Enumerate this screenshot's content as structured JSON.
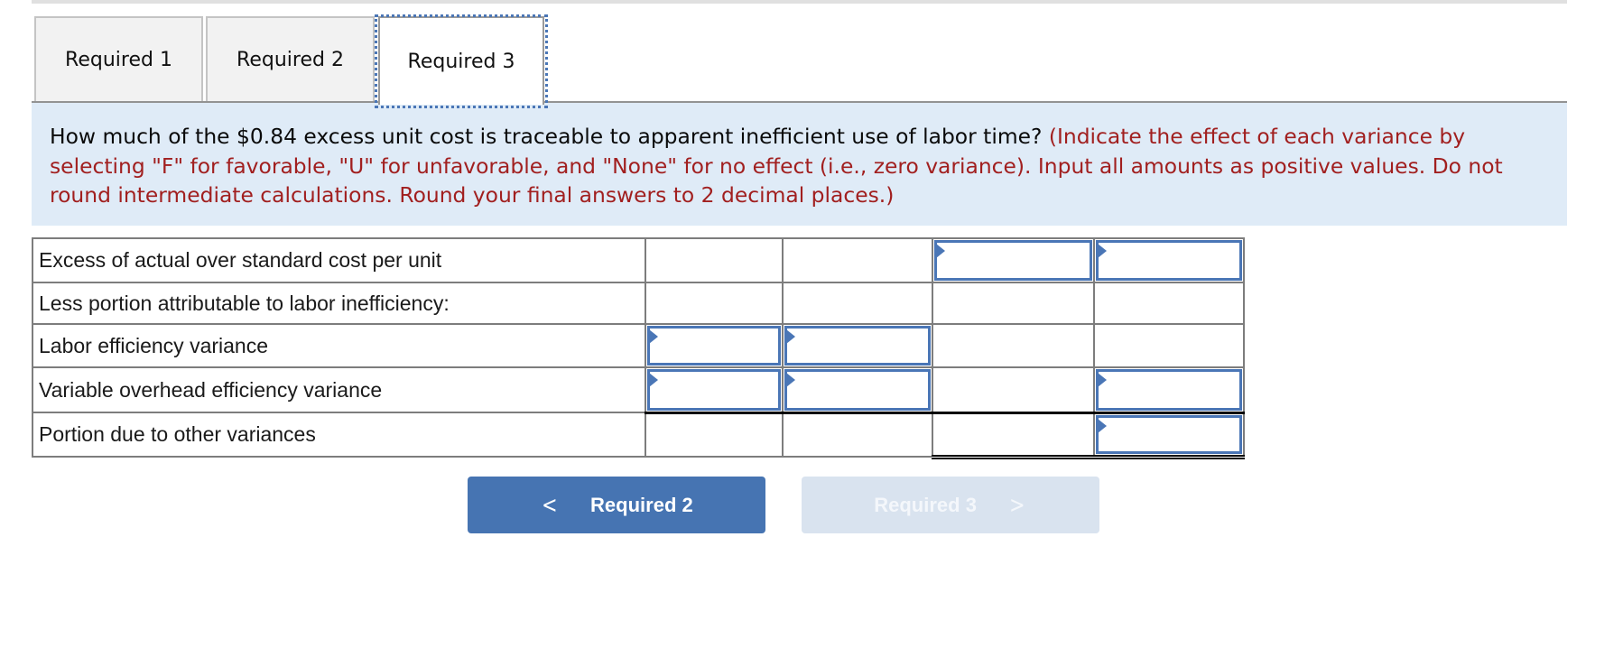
{
  "tabs": [
    {
      "label": "Required 1",
      "active": false
    },
    {
      "label": "Required 2",
      "active": false
    },
    {
      "label": "Required 3",
      "active": true
    }
  ],
  "prompt": {
    "question": "How much of the $0.84 excess unit cost is traceable to apparent inefficient use of labor time?",
    "instructions": "(Indicate the effect of each variance by selecting \"F\" for favorable, \"U\" for unfavorable, and \"None\" for no effect (i.e., zero variance). Input all amounts as positive values. Do not round intermediate calculations. Round your final answers to 2 decimal places.)"
  },
  "table": {
    "rows": [
      {
        "label": "Excess of actual over standard cost per unit",
        "inputs": {
          "c1": null,
          "c2": null,
          "c3": "",
          "c4": ""
        }
      },
      {
        "label": "Less portion attributable to labor inefficiency:",
        "inputs": {}
      },
      {
        "label": "Labor efficiency variance",
        "inputs": {
          "c1": "",
          "c2": ""
        }
      },
      {
        "label": "Variable overhead efficiency variance",
        "inputs": {
          "c1": "",
          "c2": "",
          "c4": ""
        }
      },
      {
        "label": "Portion due to other variances",
        "inputs": {
          "c4": ""
        }
      }
    ]
  },
  "nav": {
    "prev_label": "Required 2",
    "next_label": "Required 3",
    "prev_icon": "chevron-left-icon",
    "next_icon": "chevron-right-icon",
    "prev_chevron": "<",
    "next_chevron": ">"
  },
  "colors": {
    "accent": "#4674b2",
    "instruction_text": "#a11f1f",
    "prompt_background": "#dfebf7",
    "disabled_button": "#d9e3ef"
  }
}
